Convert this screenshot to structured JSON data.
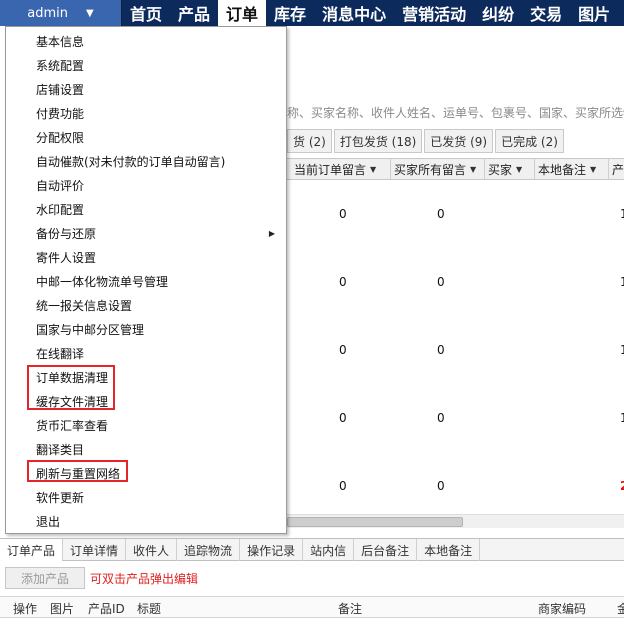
{
  "user": {
    "name": "admin"
  },
  "nav": [
    "首页",
    "产品",
    "订单",
    "库存",
    "消息中心",
    "营销活动",
    "纠纷",
    "交易",
    "图片"
  ],
  "active_nav_index": 2,
  "search_hint": "称、买家名称、收件人姓名、运单号、包裹号、国家、买家所选物",
  "status_tabs": [
    "货 (2)",
    "打包发货 (18)",
    "已发货 (9)",
    "已完成 (2)"
  ],
  "grid_columns": [
    "当前订单留言",
    "买家所有留言",
    "买家",
    "本地备注",
    "产"
  ],
  "rows": [
    {
      "a": "0",
      "b": "0",
      "edge": "1"
    },
    {
      "a": "0",
      "b": "0",
      "edge": "1"
    },
    {
      "a": "0",
      "b": "0",
      "edge": "1"
    },
    {
      "a": "0",
      "b": "0",
      "edge": "1"
    },
    {
      "a": "0",
      "b": "0",
      "edge": "2"
    }
  ],
  "menu_items": [
    {
      "label": "基本信息"
    },
    {
      "label": "系统配置"
    },
    {
      "label": "店铺设置"
    },
    {
      "label": "付费功能"
    },
    {
      "label": "分配权限"
    },
    {
      "label": "自动催款(对未付款的订单自动留言)"
    },
    {
      "label": "自动评价"
    },
    {
      "label": "水印配置"
    },
    {
      "label": "备份与还原",
      "submenu": true
    },
    {
      "label": "寄件人设置"
    },
    {
      "label": "中邮一体化物流单号管理"
    },
    {
      "label": "统一报关信息设置"
    },
    {
      "label": "国家与中邮分区管理"
    },
    {
      "label": "在线翻译"
    },
    {
      "label": "订单数据清理"
    },
    {
      "label": "缓存文件清理"
    },
    {
      "label": "货币汇率查看"
    },
    {
      "label": "翻译类目"
    },
    {
      "label": "刷新与重置网络"
    },
    {
      "label": "软件更新"
    },
    {
      "label": "退出"
    }
  ],
  "bottom_tabs": [
    "订单产品",
    "订单详情",
    "收件人",
    "追踪物流",
    "操作记录",
    "站内信",
    "后台备注",
    "本地备注"
  ],
  "add_product_label": "添加产品",
  "edit_hint": "可双击产品弹出编辑",
  "bottom_columns": [
    "操作",
    "图片",
    "产品ID",
    "标题",
    "备注",
    "商家编码",
    "金"
  ],
  "colors": {
    "nav_bg": "#0d2a5c",
    "admin_bg": "#3a66b0",
    "highlight": "#e3262b",
    "hint": "#e02020"
  }
}
